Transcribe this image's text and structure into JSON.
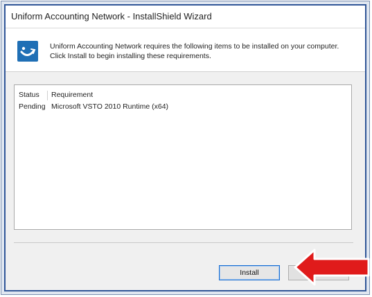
{
  "window": {
    "title": "Uniform Accounting Network - InstallShield Wizard"
  },
  "header": {
    "icon": "installshield-logo-icon",
    "message": "Uniform Accounting Network requires the following items to be installed on your computer. Click Install to begin installing these requirements."
  },
  "requirements": {
    "columns": {
      "status": "Status",
      "requirement": "Requirement"
    },
    "rows": [
      {
        "status": "Pending",
        "requirement": "Microsoft VSTO 2010 Runtime (x64)"
      }
    ]
  },
  "buttons": {
    "install_label": "Install"
  },
  "annotation": {
    "arrow_color": "#e01b1b",
    "arrow_icon": "left-arrow-icon"
  },
  "colors": {
    "frame_border": "#2f5597",
    "icon_blue": "#1f6fb5",
    "focus_blue": "#1c6fd1"
  }
}
